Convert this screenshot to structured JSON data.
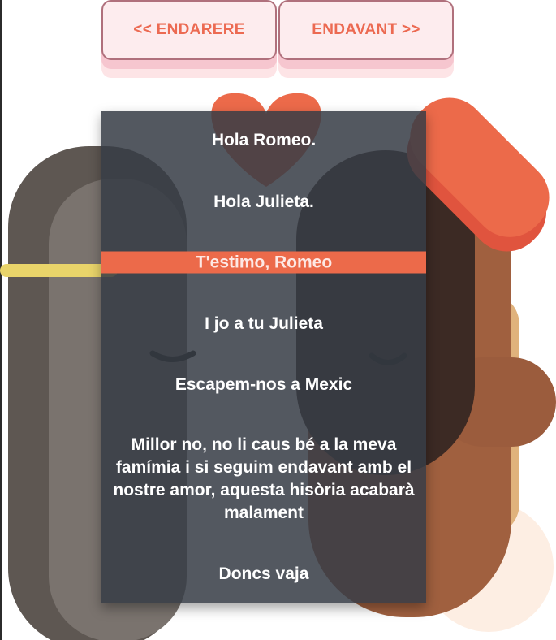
{
  "nav": {
    "prev_label": "<< ENDARERE",
    "next_label": "ENDAVANT >>"
  },
  "dialogue": [
    "Hola Romeo.",
    "Hola Julieta.",
    "T'estimo, Romeo",
    "I jo a tu Julieta",
    "Escapem-nos a Mexic",
    "Millor no, no li caus bé a la meva famímia i si seguim endavant amb el nostre amor, aquesta hisòria acabarà malament",
    "Doncs vaja"
  ],
  "highlighted_line": 2,
  "colors": {
    "accent": "#ec6a52",
    "button_bg": "#fdecee",
    "button_border": "#b0707c",
    "panel_bg": "#373c46",
    "highlight": "#ec6a4a"
  }
}
